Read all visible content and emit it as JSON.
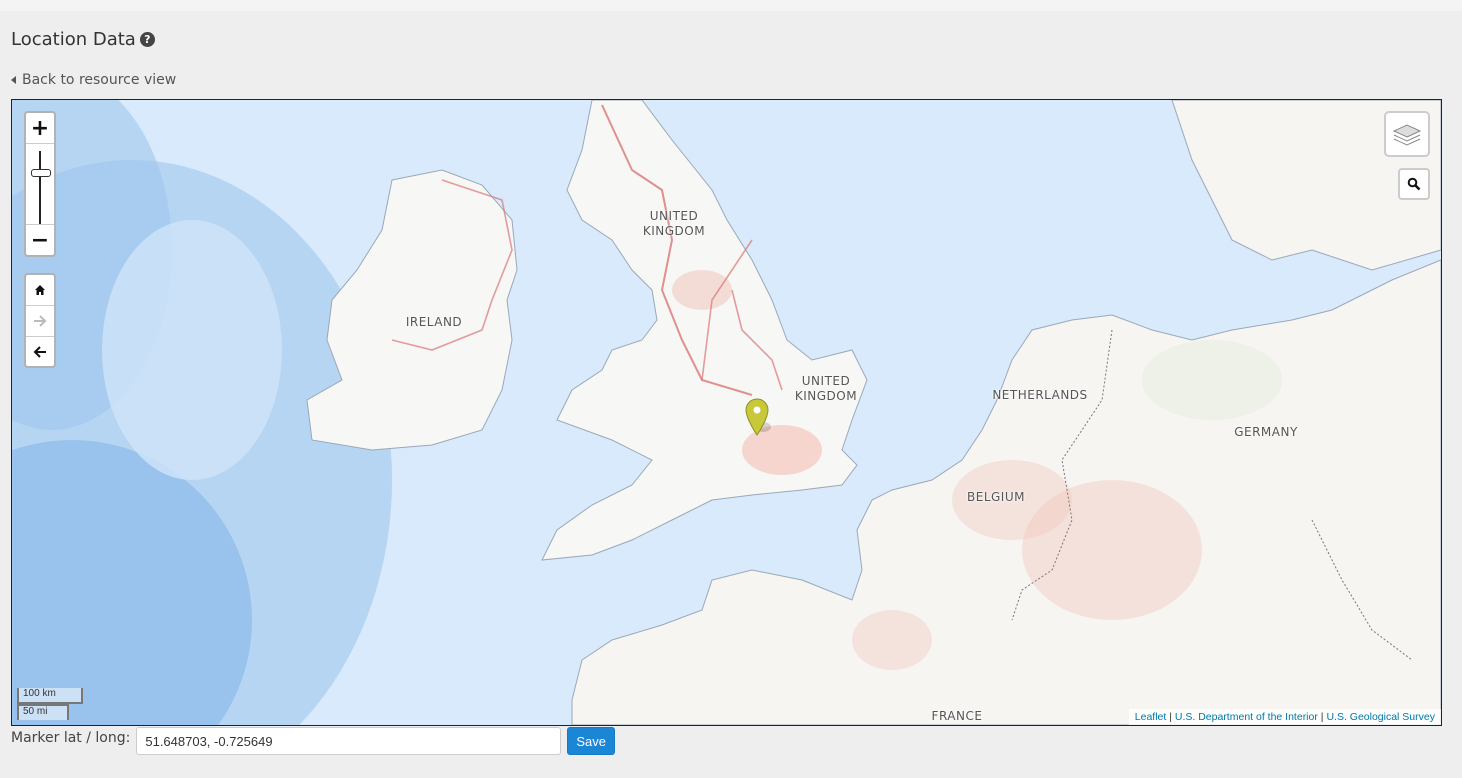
{
  "page": {
    "title": "Location Data",
    "help_icon": "question-circle-icon",
    "back_link": "Back to resource view"
  },
  "map": {
    "labels": {
      "ireland": "IRELAND",
      "uk_north": "UNITED\nKINGDOM",
      "uk_south": "UNITED\nKINGDOM",
      "netherlands": "NETHERLANDS",
      "belgium": "BELGIUM",
      "germany": "GERMANY",
      "france": "FRANCE"
    },
    "scale": {
      "km": "100 km",
      "mi": "50 mi"
    },
    "attribution": {
      "leaflet": "Leaflet",
      "separator": "|",
      "doi": "U.S. Department of the Interior",
      "usgs": "U.S. Geological Survey"
    },
    "controls": {
      "zoom_in": "+",
      "zoom_out": "−",
      "icons": [
        "home-icon",
        "arrow-right-icon",
        "arrow-left-icon",
        "layers-icon",
        "search-icon"
      ]
    },
    "marker_color": "#c8c83a"
  },
  "form": {
    "label": "Marker lat / long:",
    "value": "51.648703, -0.725649",
    "save": "Save"
  }
}
